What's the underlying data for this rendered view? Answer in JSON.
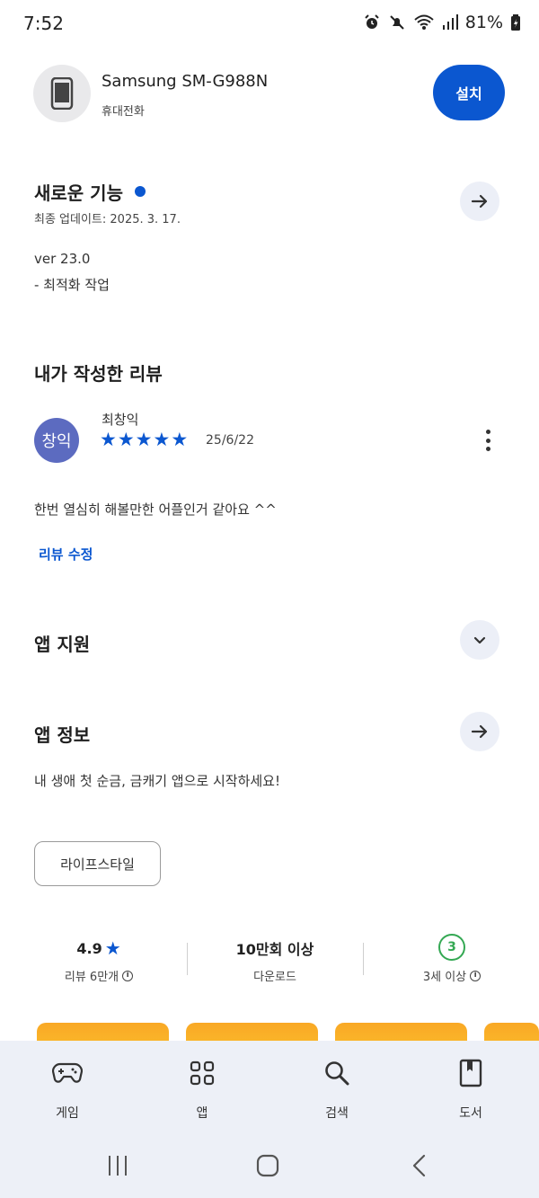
{
  "status_bar": {
    "time": "7:52",
    "battery": "81%",
    "icons": [
      "alarm-icon",
      "mute-icon",
      "wifi-icon",
      "signal-icon",
      "battery-icon"
    ]
  },
  "device": {
    "name": "Samsung SM-G988N",
    "type": "휴대전화",
    "install_label": "설치",
    "icon": "phone-icon"
  },
  "whats_new": {
    "title": "새로운 기능",
    "updated": "최종 업데이트: 2025. 3. 17.",
    "lines": [
      "ver 23.0",
      "- 최적화 작업"
    ]
  },
  "my_review": {
    "title": "내가 작성한 리뷰",
    "avatar_text": "창익",
    "reviewer": "최창익",
    "rating": 5,
    "date": "25/6/22",
    "text": "한번 열심히 해볼만한 어플인거 같아요 ^^",
    "edit_label": "리뷰 수정"
  },
  "app_support": {
    "title": "앱 지원"
  },
  "app_info": {
    "title": "앱 정보",
    "description": "내 생애 첫 순금, 금캐기 앱으로 시작하세요!",
    "category_chip": "라이프스타일"
  },
  "stats": {
    "rating_value": "4.9",
    "rating_label": "리뷰 6만개",
    "downloads_value": "10만회 이상",
    "downloads_label": "다운로드",
    "age_value": "3",
    "age_label": "3세 이상"
  },
  "bottom_nav": [
    {
      "label": "게임",
      "icon": "gamepad-icon"
    },
    {
      "label": "앱",
      "icon": "apps-grid-icon"
    },
    {
      "label": "검색",
      "icon": "search-icon"
    },
    {
      "label": "도서",
      "icon": "book-icon"
    }
  ],
  "colors": {
    "accent": "#0b57d0",
    "avatar_bg": "#5c6bc0",
    "age_green": "#34a853",
    "nav_bg": "#edf0f7"
  }
}
